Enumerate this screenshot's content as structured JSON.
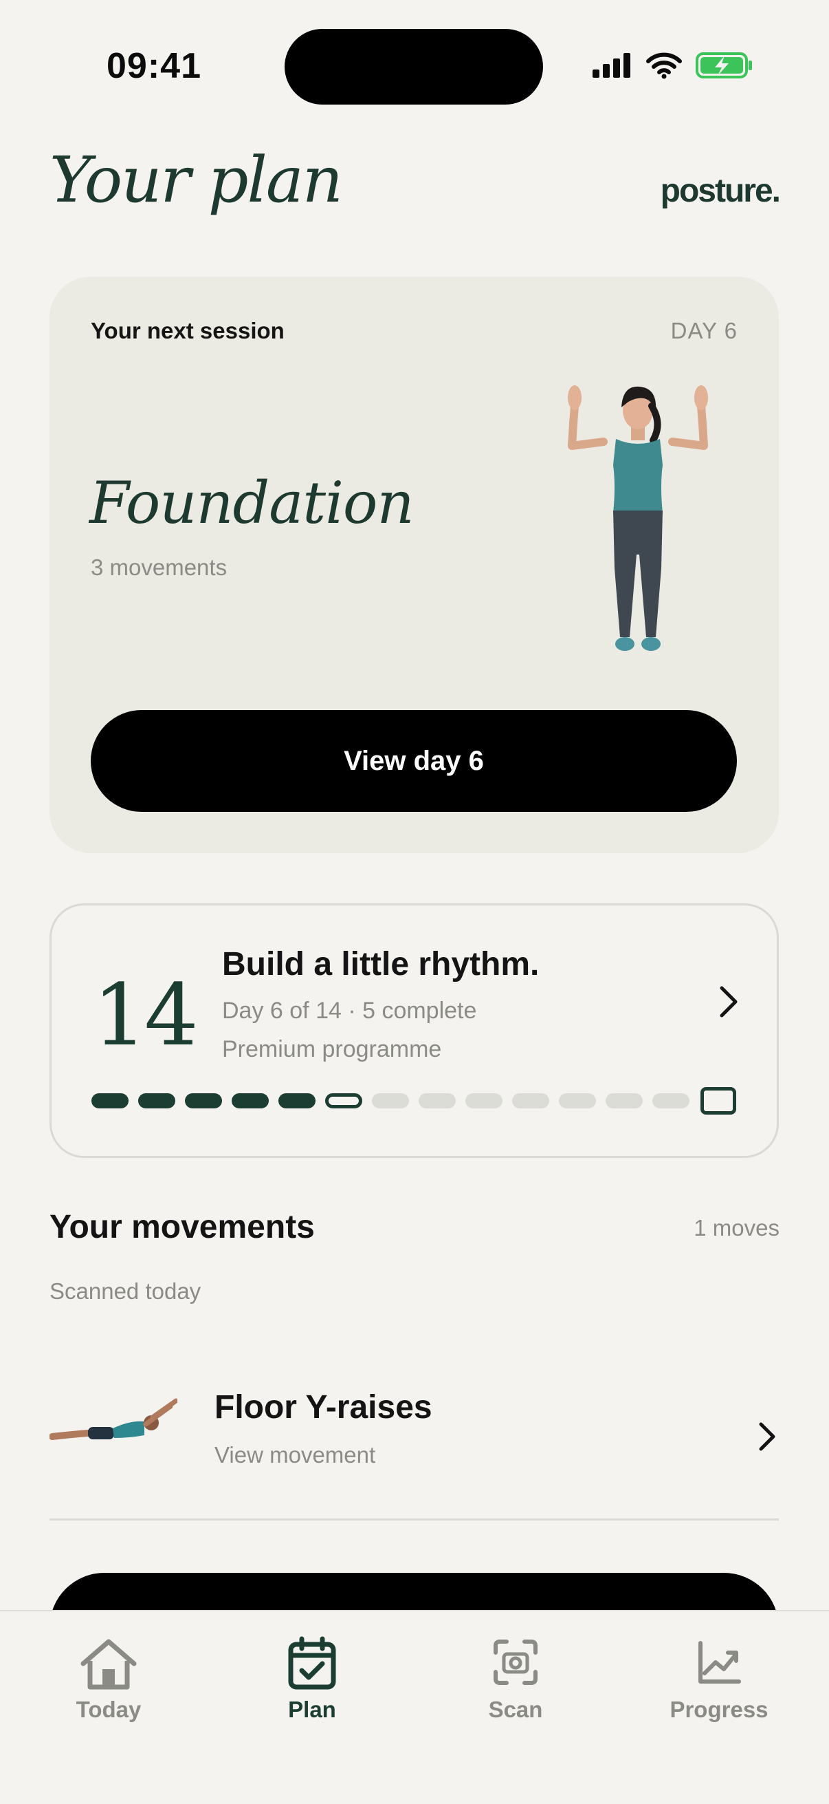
{
  "status_bar": {
    "time": "09:41"
  },
  "header": {
    "title": "Your plan",
    "brand": "posture."
  },
  "session": {
    "label": "Your next session",
    "day_tag": "DAY 6",
    "name": "Foundation",
    "subtitle": "3 movements",
    "button_label": "View day 6"
  },
  "programme": {
    "total_days": "14",
    "title": "Build a little rhythm.",
    "meta": "Day 6 of 14 · 5 complete",
    "type": "Premium programme",
    "completed": 5,
    "current_day": 6,
    "days": 14
  },
  "movements": {
    "title": "Your movements",
    "count": "1 moves",
    "subtitle": "Scanned today",
    "items": [
      {
        "name": "Floor Y-raises",
        "link": "View movement"
      }
    ]
  },
  "tabs": [
    {
      "label": "Today",
      "icon": "home-icon",
      "active": false
    },
    {
      "label": "Plan",
      "icon": "calendar-check-icon",
      "active": true
    },
    {
      "label": "Scan",
      "icon": "camera-scan-icon",
      "active": false
    },
    {
      "label": "Progress",
      "icon": "chart-trend-icon",
      "active": false
    }
  ],
  "colors": {
    "accent": "#1b3d32",
    "background": "#f4f3ef",
    "card": "#ebebe4",
    "muted": "#8b8b86"
  }
}
